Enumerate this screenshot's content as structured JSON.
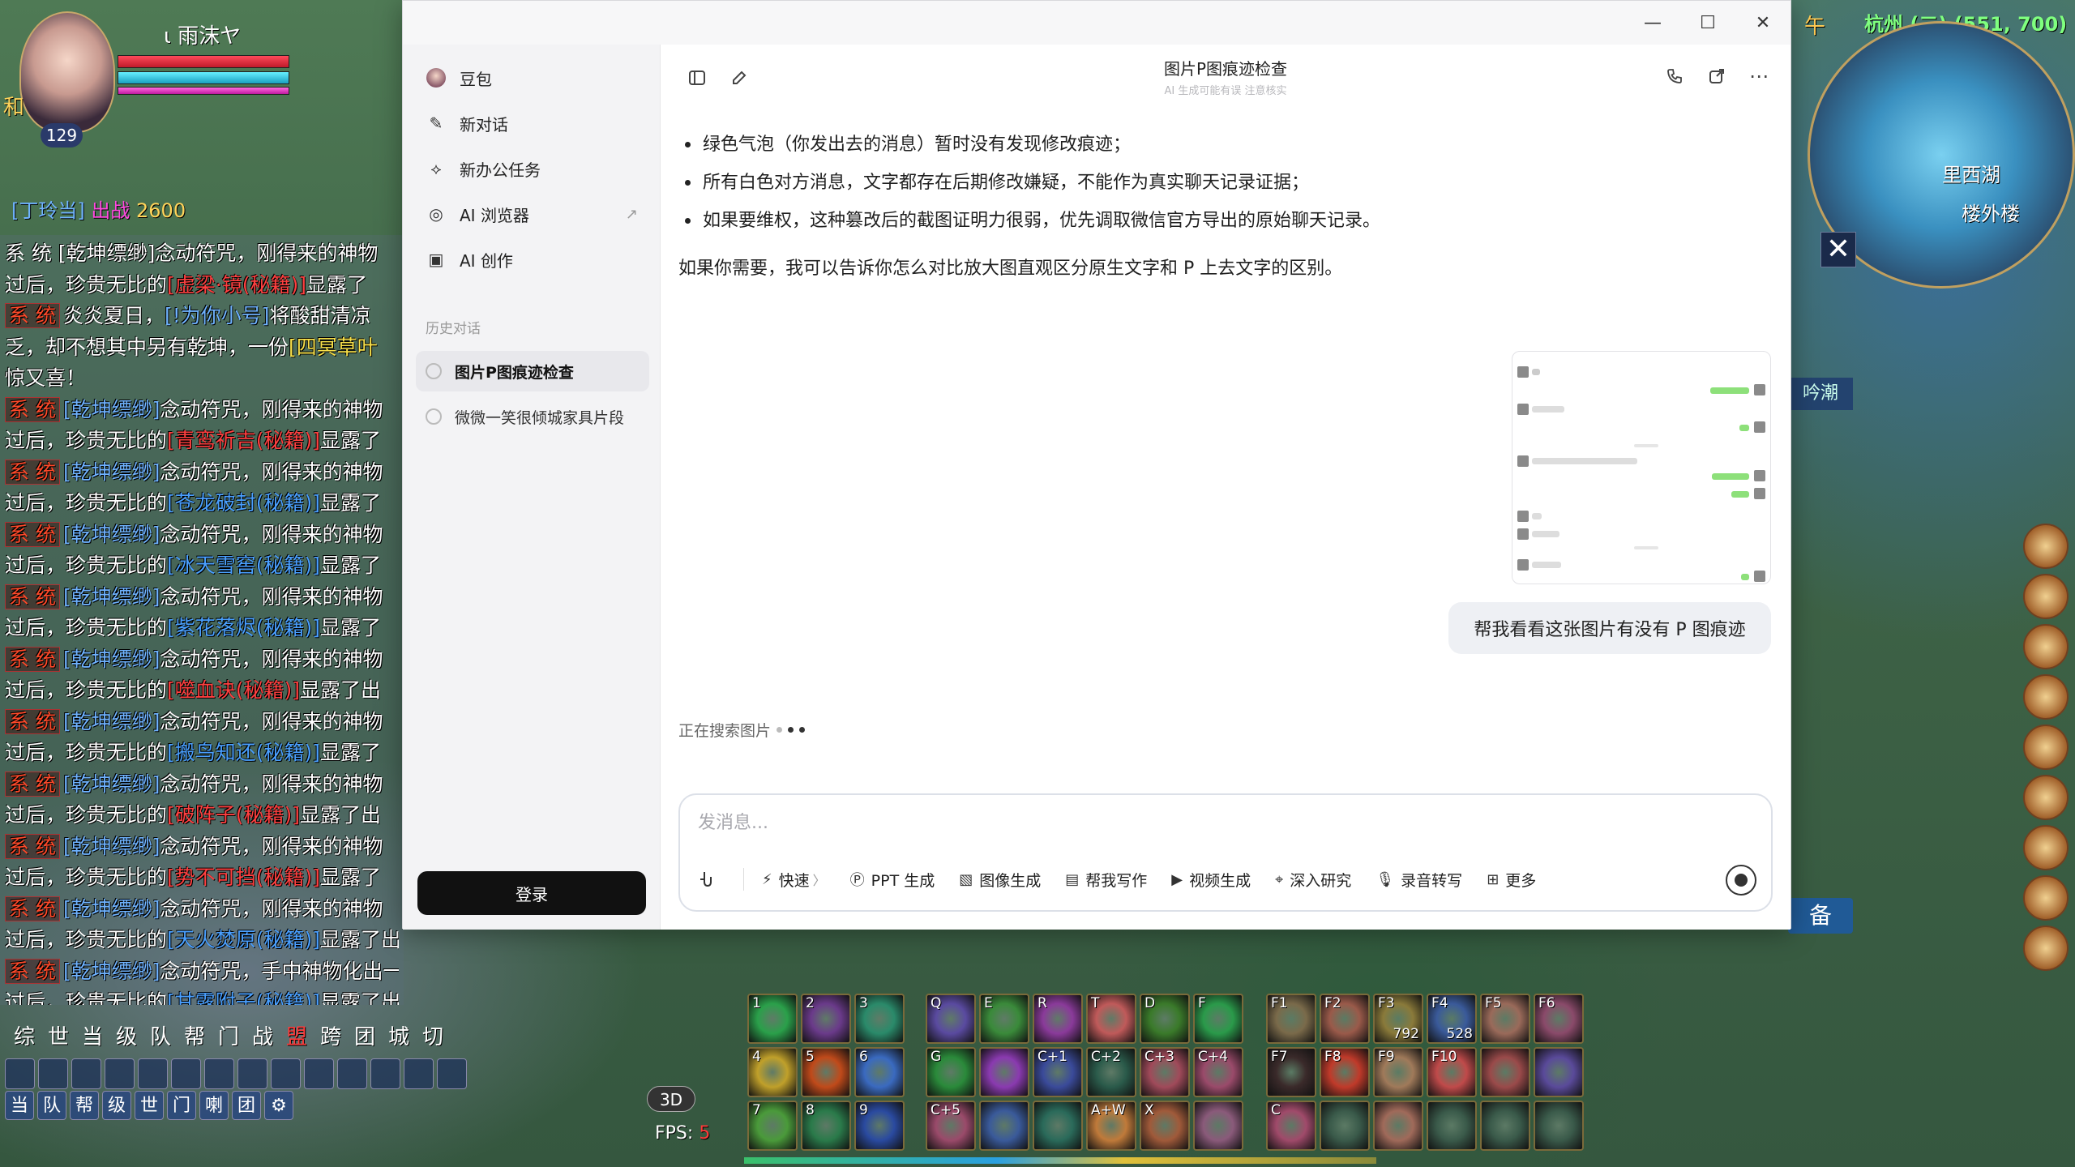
{
  "game": {
    "player": {
      "name": "ι 雨沫ヤ",
      "level": "129",
      "badge": "和"
    },
    "pet_line": {
      "name": "[丁玲当]",
      "status": "出战",
      "value": "2600"
    },
    "chat": [
      {
        "tag": "",
        "pre": "",
        "name": "",
        "mid": "",
        "item": "",
        "post": "系 统 [乾坤缥缈]念动符咒，刚得来的神物",
        "color": "blue"
      },
      {
        "tag": "",
        "pre": "过后，珍贵无比的",
        "name": "",
        "mid": "",
        "item": "[虚梁·镜(秘籍)]",
        "post": "显露了",
        "color": "red"
      },
      {
        "tag": "系 统",
        "pre": "炎炎夏日，",
        "name": "[!为你小号]",
        "mid": "将酸甜清凉",
        "item": "",
        "post": "",
        "color": "yellow"
      },
      {
        "tag": "",
        "pre": "乏，却不想其中另有乾坤，一份",
        "name": "",
        "mid": "",
        "item": "[四冥草叶",
        "post": "",
        "color": "yellow"
      },
      {
        "tag": "",
        "pre": "惊又喜！",
        "name": "",
        "mid": "",
        "item": "",
        "post": "",
        "color": "yellow"
      },
      {
        "tag": "系 统",
        "pre": "",
        "name": "[乾坤缥缈]",
        "mid": "念动符咒，刚得来的神物",
        "item": "",
        "post": "",
        "color": "blue"
      },
      {
        "tag": "",
        "pre": "过后，珍贵无比的",
        "name": "",
        "mid": "",
        "item": "[青鸾祈吉(秘籍)]",
        "post": "显露了",
        "color": "red"
      },
      {
        "tag": "系 统",
        "pre": "",
        "name": "[乾坤缥缈]",
        "mid": "念动符咒，刚得来的神物",
        "item": "",
        "post": "",
        "color": "blue"
      },
      {
        "tag": "",
        "pre": "过后，珍贵无比的",
        "name": "",
        "mid": "",
        "item": "[苍龙破封(秘籍)]",
        "post": "显露了",
        "color": "blue"
      },
      {
        "tag": "系 统",
        "pre": "",
        "name": "[乾坤缥缈]",
        "mid": "念动符咒，刚得来的神物",
        "item": "",
        "post": "",
        "color": "blue"
      },
      {
        "tag": "",
        "pre": "过后，珍贵无比的",
        "name": "",
        "mid": "",
        "item": "[冰天雪窖(秘籍)]",
        "post": "显露了",
        "color": "blue"
      },
      {
        "tag": "系 统",
        "pre": "",
        "name": "[乾坤缥缈]",
        "mid": "念动符咒，刚得来的神物",
        "item": "",
        "post": "",
        "color": "blue"
      },
      {
        "tag": "",
        "pre": "过后，珍贵无比的",
        "name": "",
        "mid": "",
        "item": "[紫花落烬(秘籍)]",
        "post": "显露了",
        "color": "blue"
      },
      {
        "tag": "系 统",
        "pre": "",
        "name": "[乾坤缥缈]",
        "mid": "念动符咒，刚得来的神物",
        "item": "",
        "post": "",
        "color": "blue"
      },
      {
        "tag": "",
        "pre": "过后，珍贵无比的",
        "name": "",
        "mid": "",
        "item": "[噬血诀(秘籍)]",
        "post": "显露了出",
        "color": "red"
      },
      {
        "tag": "系 统",
        "pre": "",
        "name": "[乾坤缥缈]",
        "mid": "念动符咒，刚得来的神物",
        "item": "",
        "post": "",
        "color": "blue"
      },
      {
        "tag": "",
        "pre": "过后，珍贵无比的",
        "name": "",
        "mid": "",
        "item": "[搬鸟知还(秘籍)]",
        "post": "显露了",
        "color": "blue"
      },
      {
        "tag": "系 统",
        "pre": "",
        "name": "[乾坤缥缈]",
        "mid": "念动符咒，刚得来的神物",
        "item": "",
        "post": "",
        "color": "blue"
      },
      {
        "tag": "",
        "pre": "过后，珍贵无比的",
        "name": "",
        "mid": "",
        "item": "[破阵子(秘籍)]",
        "post": "显露了出",
        "color": "red"
      },
      {
        "tag": "系 统",
        "pre": "",
        "name": "[乾坤缥缈]",
        "mid": "念动符咒，刚得来的神物",
        "item": "",
        "post": "",
        "color": "blue"
      },
      {
        "tag": "",
        "pre": "过后，珍贵无比的",
        "name": "",
        "mid": "",
        "item": "[势不可挡(秘籍)]",
        "post": "显露了",
        "color": "red"
      },
      {
        "tag": "系 统",
        "pre": "",
        "name": "[乾坤缥缈]",
        "mid": "念动符咒，刚得来的神物",
        "item": "",
        "post": "",
        "color": "blue"
      },
      {
        "tag": "",
        "pre": "过后，珍贵无比的",
        "name": "",
        "mid": "",
        "item": "[天火焚原(秘籍)]",
        "post": "显露了出来。",
        "color": "blue"
      },
      {
        "tag": "系 统",
        "pre": "",
        "name": "[乾坤缥缈]",
        "mid": "念动符咒，手中神物化出一股青烟，青烟",
        "item": "",
        "post": "",
        "color": "blue"
      },
      {
        "tag": "",
        "pre": "过后，珍贵无比的",
        "name": "",
        "mid": "",
        "item": "[甘露附子(秘籍)]",
        "post": "显露了出来。",
        "color": "blue"
      }
    ],
    "channels": [
      "综",
      "世",
      "当",
      "级",
      "队",
      "帮",
      "门",
      "战",
      "盟",
      "跨",
      "团",
      "城",
      "切"
    ],
    "channels_row2": [
      "当",
      "队",
      "帮",
      "级",
      "世",
      "门",
      "喇",
      "团",
      "⚙"
    ],
    "fps_label": "FPS:",
    "fps_value": "5",
    "mode_3d": "3D",
    "map": {
      "region": "杭州 (二) (551, 700)",
      "place1": "里西湖",
      "place2": "楼外楼",
      "time": "午"
    },
    "side_tab": "吟潮",
    "side_btn": "备",
    "skills": [
      {
        "key": "1",
        "cnt": "",
        "c": "#2aa04a"
      },
      {
        "key": "2",
        "cnt": "",
        "c": "#6a3a8a"
      },
      {
        "key": "3",
        "cnt": "",
        "c": "#2a8a6a"
      },
      {
        "key": "Q",
        "cnt": "",
        "c": "#5a4aa0"
      },
      {
        "key": "E",
        "cnt": "",
        "c": "#3a8a3a"
      },
      {
        "key": "R",
        "cnt": "",
        "c": "#8a3a9a"
      },
      {
        "key": "T",
        "cnt": "",
        "c": "#c05a5a"
      },
      {
        "key": "D",
        "cnt": "",
        "c": "#3a7a2a"
      },
      {
        "key": "F",
        "cnt": "",
        "c": "#2a9a4a"
      },
      {
        "key": "F1",
        "cnt": "",
        "c": "#7a6a4a"
      },
      {
        "key": "F2",
        "cnt": "",
        "c": "#9a5a4a"
      },
      {
        "key": "F3",
        "cnt": "792",
        "c": "#8a7a3a"
      },
      {
        "key": "F4",
        "cnt": "528",
        "c": "#3a5a9a"
      },
      {
        "key": "F5",
        "cnt": "",
        "c": "#9a6a5a"
      },
      {
        "key": "F6",
        "cnt": "",
        "c": "#8a4a6a"
      },
      {
        "key": "4",
        "cnt": "",
        "c": "#c0a02a"
      },
      {
        "key": "5",
        "cnt": "",
        "c": "#c04a1a"
      },
      {
        "key": "6",
        "cnt": "",
        "c": "#3a6ac0"
      },
      {
        "key": "G",
        "cnt": "",
        "c": "#2a8a3a"
      },
      {
        "key": "",
        "cnt": "",
        "c": "#8a3ab0"
      },
      {
        "key": "C+1",
        "cnt": "",
        "c": "#3a4a9a"
      },
      {
        "key": "C+2",
        "cnt": "",
        "c": "#2a5a4a"
      },
      {
        "key": "C+3",
        "cnt": "",
        "c": "#a04a5a"
      },
      {
        "key": "C+4",
        "cnt": "",
        "c": "#9a4a6a"
      },
      {
        "key": "F7",
        "cnt": "",
        "c": "#3a2a2a"
      },
      {
        "key": "F8",
        "cnt": "",
        "c": "#c03a2a"
      },
      {
        "key": "F9",
        "cnt": "",
        "c": "#a07a5a"
      },
      {
        "key": "F10",
        "cnt": "",
        "c": "#c04a4a"
      },
      {
        "key": "",
        "cnt": "",
        "c": "#9a4a4a"
      },
      {
        "key": "",
        "cnt": "",
        "c": "#5a4a9a"
      },
      {
        "key": "7",
        "cnt": "",
        "c": "#4a9a3a"
      },
      {
        "key": "8",
        "cnt": "",
        "c": "#2a7a4a"
      },
      {
        "key": "9",
        "cnt": "",
        "c": "#2a4aa0"
      },
      {
        "key": "C+5",
        "cnt": "",
        "c": "#9a4a6a"
      },
      {
        "key": "",
        "cnt": "",
        "c": "#3a5a9a"
      },
      {
        "key": "",
        "cnt": "",
        "c": "#2a6a5a"
      },
      {
        "key": "A+W",
        "cnt": "",
        "c": "#c07a3a"
      },
      {
        "key": "X",
        "cnt": "",
        "c": "#a05a3a"
      },
      {
        "key": "",
        "cnt": "",
        "c": "#8a5a7a"
      },
      {
        "key": "C",
        "cnt": "",
        "c": "#a04a6a"
      },
      {
        "key": "",
        "cnt": "",
        "c": "#3a5a4a"
      },
      {
        "key": "",
        "cnt": "",
        "c": "#a06a5a"
      },
      {
        "key": "",
        "cnt": "",
        "c": "#3a5a4a"
      },
      {
        "key": "",
        "cnt": "",
        "c": "#3a5a4a"
      },
      {
        "key": "",
        "cnt": "",
        "c": "#3a5a4a"
      }
    ]
  },
  "app": {
    "sidebar": {
      "brand": "豆包",
      "items": [
        {
          "label": "新对话",
          "icon": "✎"
        },
        {
          "label": "新办公任务",
          "icon": "⟡"
        },
        {
          "label": "AI 浏览器",
          "icon": "◎",
          "ext": "↗"
        },
        {
          "label": "AI 创作",
          "icon": "▣"
        }
      ],
      "history_label": "历史对话",
      "history": [
        {
          "label": "图片P图痕迹检查",
          "active": true
        },
        {
          "label": "微微一笑很倾城家具片段",
          "active": false
        }
      ],
      "login": "登录"
    },
    "header": {
      "title": "图片P图痕迹检查",
      "subtitle": "AI 生成可能有误 注意核实"
    },
    "reply": {
      "bullets": [
        "绿色气泡（你发出去的消息）暂时没有发现修改痕迹；",
        "所有白色对方消息，文字都存在后期修改嫌疑，不能作为真实聊天记录证据；",
        "如果要维权，这种篡改后的截图证明力很弱，优先调取微信官方导出的原始聊天记录。"
      ],
      "tail": "如果你需要，我可以告诉你怎么对比放大图直观区分原生文字和 P 上去文字的区别。"
    },
    "user_message": "帮我看看这张图片有没有 P 图痕迹",
    "searching": "正在搜索图片",
    "composer": {
      "placeholder": "发消息...",
      "tools": [
        {
          "label": "快速",
          "icon": "⚡",
          "chev": "〉"
        },
        {
          "label": "PPT 生成",
          "icon": "Ⓟ"
        },
        {
          "label": "图像生成",
          "icon": "▧"
        },
        {
          "label": "帮我写作",
          "icon": "▤"
        },
        {
          "label": "视频生成",
          "icon": "▶"
        },
        {
          "label": "深入研究",
          "icon": "⌖"
        },
        {
          "label": "录音转写",
          "icon": "🎙"
        },
        {
          "label": "更多",
          "icon": "⊞"
        }
      ]
    }
  }
}
